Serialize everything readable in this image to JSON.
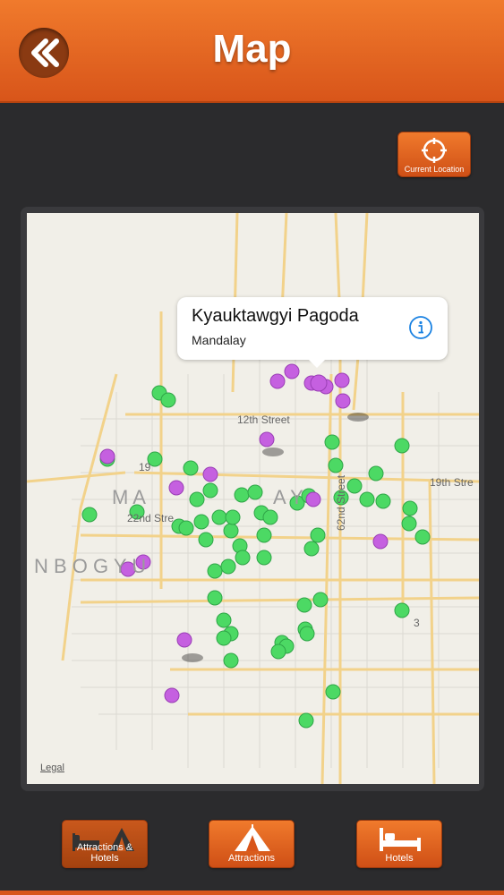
{
  "header": {
    "title": "Map"
  },
  "current_location": {
    "label": "Current Location"
  },
  "map": {
    "legal": "Legal",
    "labels": {
      "street_12th": "12th Street",
      "street_19th": "19th Stre",
      "street_26th_a": "19",
      "street_22nd": "22nd Stre",
      "street_62nd": "62nd Street",
      "area_a": "M A",
      "area_b": "A Y",
      "area_c": "N B O G Y U",
      "road_num": "3"
    },
    "callout": {
      "title": "Kyauktawgyi Pagoda",
      "subtitle": "Mandalay"
    }
  },
  "tabs": [
    {
      "label": "Attractions & Hotels",
      "icon": "bed-and-tent-icon",
      "selected": true
    },
    {
      "label": "Attractions",
      "icon": "tent-icon",
      "selected": false
    },
    {
      "label": "Hotels",
      "icon": "bed-icon",
      "selected": false
    }
  ],
  "colors": {
    "accent": "#e8671f",
    "attraction_pin": "#4cd964",
    "hotel_pin": "#c560e0"
  }
}
